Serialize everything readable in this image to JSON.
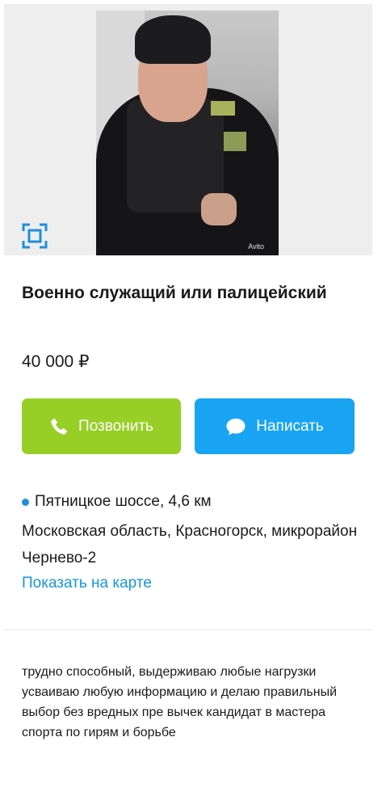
{
  "listing": {
    "title": "Военно служащий или палицейский",
    "price": "40 000 ₽",
    "photo_watermark": "Avito"
  },
  "actions": {
    "call_label": "Позвонить",
    "message_label": "Написать",
    "call_color": "#97cf26",
    "message_color": "#18a4f2"
  },
  "location": {
    "metro": "Пятницкое шоссе, 4,6 км",
    "address": "Московская область, Красногорск, микрорайон Чернево-2",
    "map_link": "Показать на карте",
    "metro_color": "#1e8fde"
  },
  "description": "трудно способный, выдерживаю любые нагрузки усваиваю любую информацию и делаю правильный выбор без вредных пре вычек кандидат в мастера спорта по гирям и борьбе",
  "icons": {
    "expand": "expand-icon",
    "phone": "phone-icon",
    "chat": "chat-bubble-icon"
  }
}
